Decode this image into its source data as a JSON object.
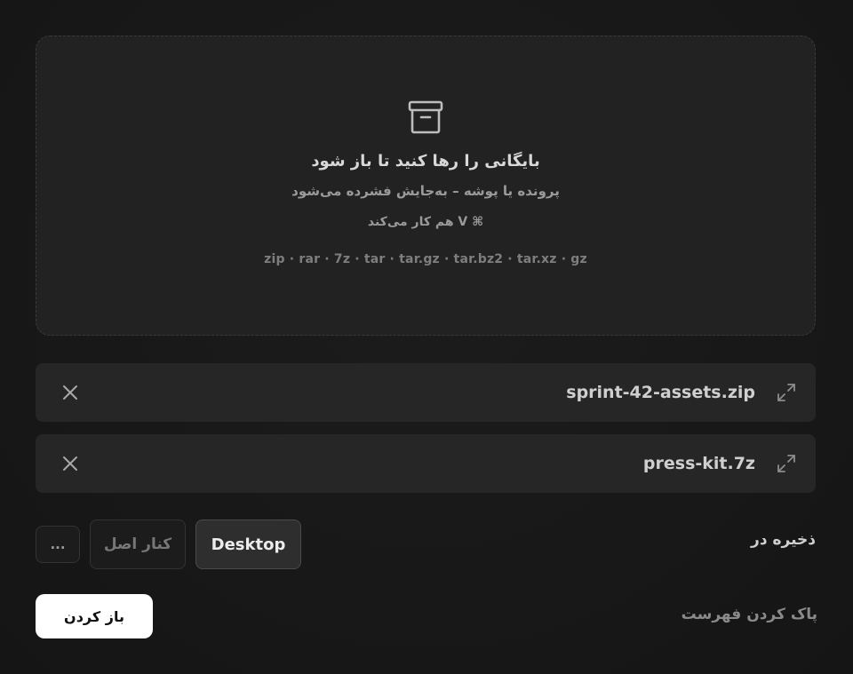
{
  "dropzone": {
    "icon": "archive-box-icon",
    "title": "بایگانی را رها کنید تا باز شود",
    "subtitle": "پرونده یا پوشه – به‌جایش فشرده می‌شود",
    "shortcut": "⌘ V هم کار می‌کند",
    "formats": "zip · rar · 7z · tar · tar.gz · tar.bz2 · tar.xz · gz"
  },
  "files": [
    {
      "name": "sprint-42-assets.zip"
    },
    {
      "name": "press-kit.7z"
    }
  ],
  "save": {
    "label": "ذخیره در",
    "options": {
      "desktop": "Desktop",
      "next_to_original": "کنار اصل",
      "more": "..."
    },
    "selected": "Desktop"
  },
  "actions": {
    "open": "باز کردن",
    "clear": "پاک کردن فهرست"
  }
}
